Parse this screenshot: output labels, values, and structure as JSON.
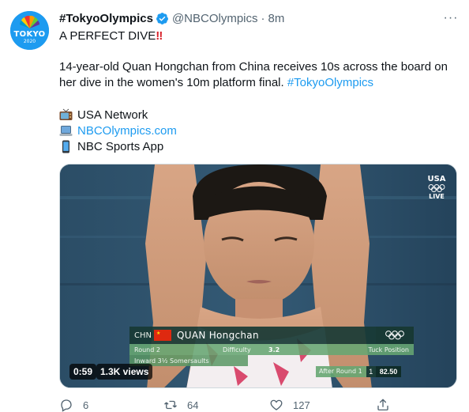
{
  "tweet": {
    "avatar": {
      "line1": "TOKYO",
      "line2": "2020"
    },
    "display_name": "#TokyoOlympics",
    "handle": "@NBCOlympics",
    "dot": "·",
    "time": "8m",
    "more": "···",
    "headline": "A PERFECT DIVE",
    "headline_emoji": "‼",
    "body_line1": "14-year-old Quan Hongchan from China receives 10s across the board on",
    "body_line2": "her dive in the women's 10m platform final.",
    "hashtag": "#TokyoOlympics",
    "links": [
      {
        "icon": "tv-icon",
        "text": "USA Network"
      },
      {
        "icon": "laptop-icon",
        "text": "NBCOlympics.com"
      },
      {
        "icon": "mobile-phone-icon",
        "text": "NBC Sports App"
      }
    ]
  },
  "media": {
    "network": {
      "name": "USA",
      "live": "LIVE"
    },
    "graphic": {
      "country": "CHN",
      "flag_star": "★",
      "athlete": "QUAN Hongchan",
      "round": "Round 2",
      "difficulty_label": "Difficulty",
      "difficulty_value": "3.2",
      "position": "Tuck Position",
      "dive": "Inward 3½ Somersaults",
      "after_label": "After Round 1",
      "rank": "1",
      "score": "82.50"
    },
    "duration": "0:59",
    "views": "1.3K views"
  },
  "actions": {
    "replies": "6",
    "retweets": "64",
    "likes": "127"
  },
  "colors": {
    "link": "#1d9bf0",
    "text": "#0f1419",
    "secondary": "#536471",
    "graphic_dark": "#183935",
    "graphic_green": "#67a672"
  }
}
